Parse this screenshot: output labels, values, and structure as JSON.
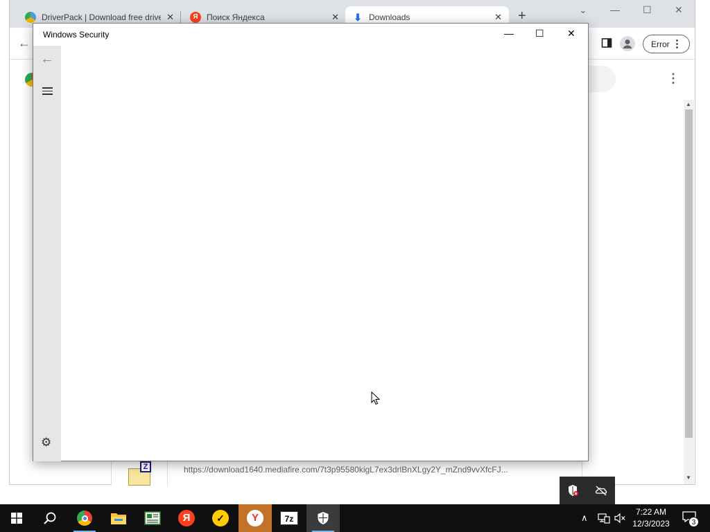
{
  "browser": {
    "tabs": [
      {
        "title": "DriverPack | Download free drive",
        "favicon_color": "#4b9fdb",
        "active": false
      },
      {
        "title": "Поиск Яндекса",
        "favicon_color": "#fc3f1d",
        "active": false
      },
      {
        "title": "Downloads",
        "favicon_color": "#1a73e8",
        "active": true
      }
    ],
    "new_tab_label": "+",
    "profile_status": "Error",
    "download": {
      "file_badge": "Z",
      "url": "https://download1640.mediafire.com/7t3p95580kigL7ex3drlBnXLgy2Y_mZnd9vvXfcFJ..."
    }
  },
  "security_window": {
    "title": "Windows Security"
  },
  "taskbar": {
    "apps": [
      {
        "name": "Chrome",
        "running": true,
        "active": false
      },
      {
        "name": "File Explorer",
        "running": false,
        "active": false
      },
      {
        "name": "Editor",
        "running": false,
        "active": false
      },
      {
        "name": "Yandex",
        "running": false,
        "active": false
      },
      {
        "name": "Yandex Market",
        "running": false,
        "active": false
      },
      {
        "name": "Yandex Browser",
        "running": false,
        "active": true
      },
      {
        "name": "7-Zip",
        "running": false,
        "active": false
      },
      {
        "name": "Windows Security",
        "running": true,
        "active": true
      }
    ],
    "seven_zip_label": "7z",
    "time": "7:22 AM",
    "date": "12/3/2023",
    "notification_count": "3"
  }
}
